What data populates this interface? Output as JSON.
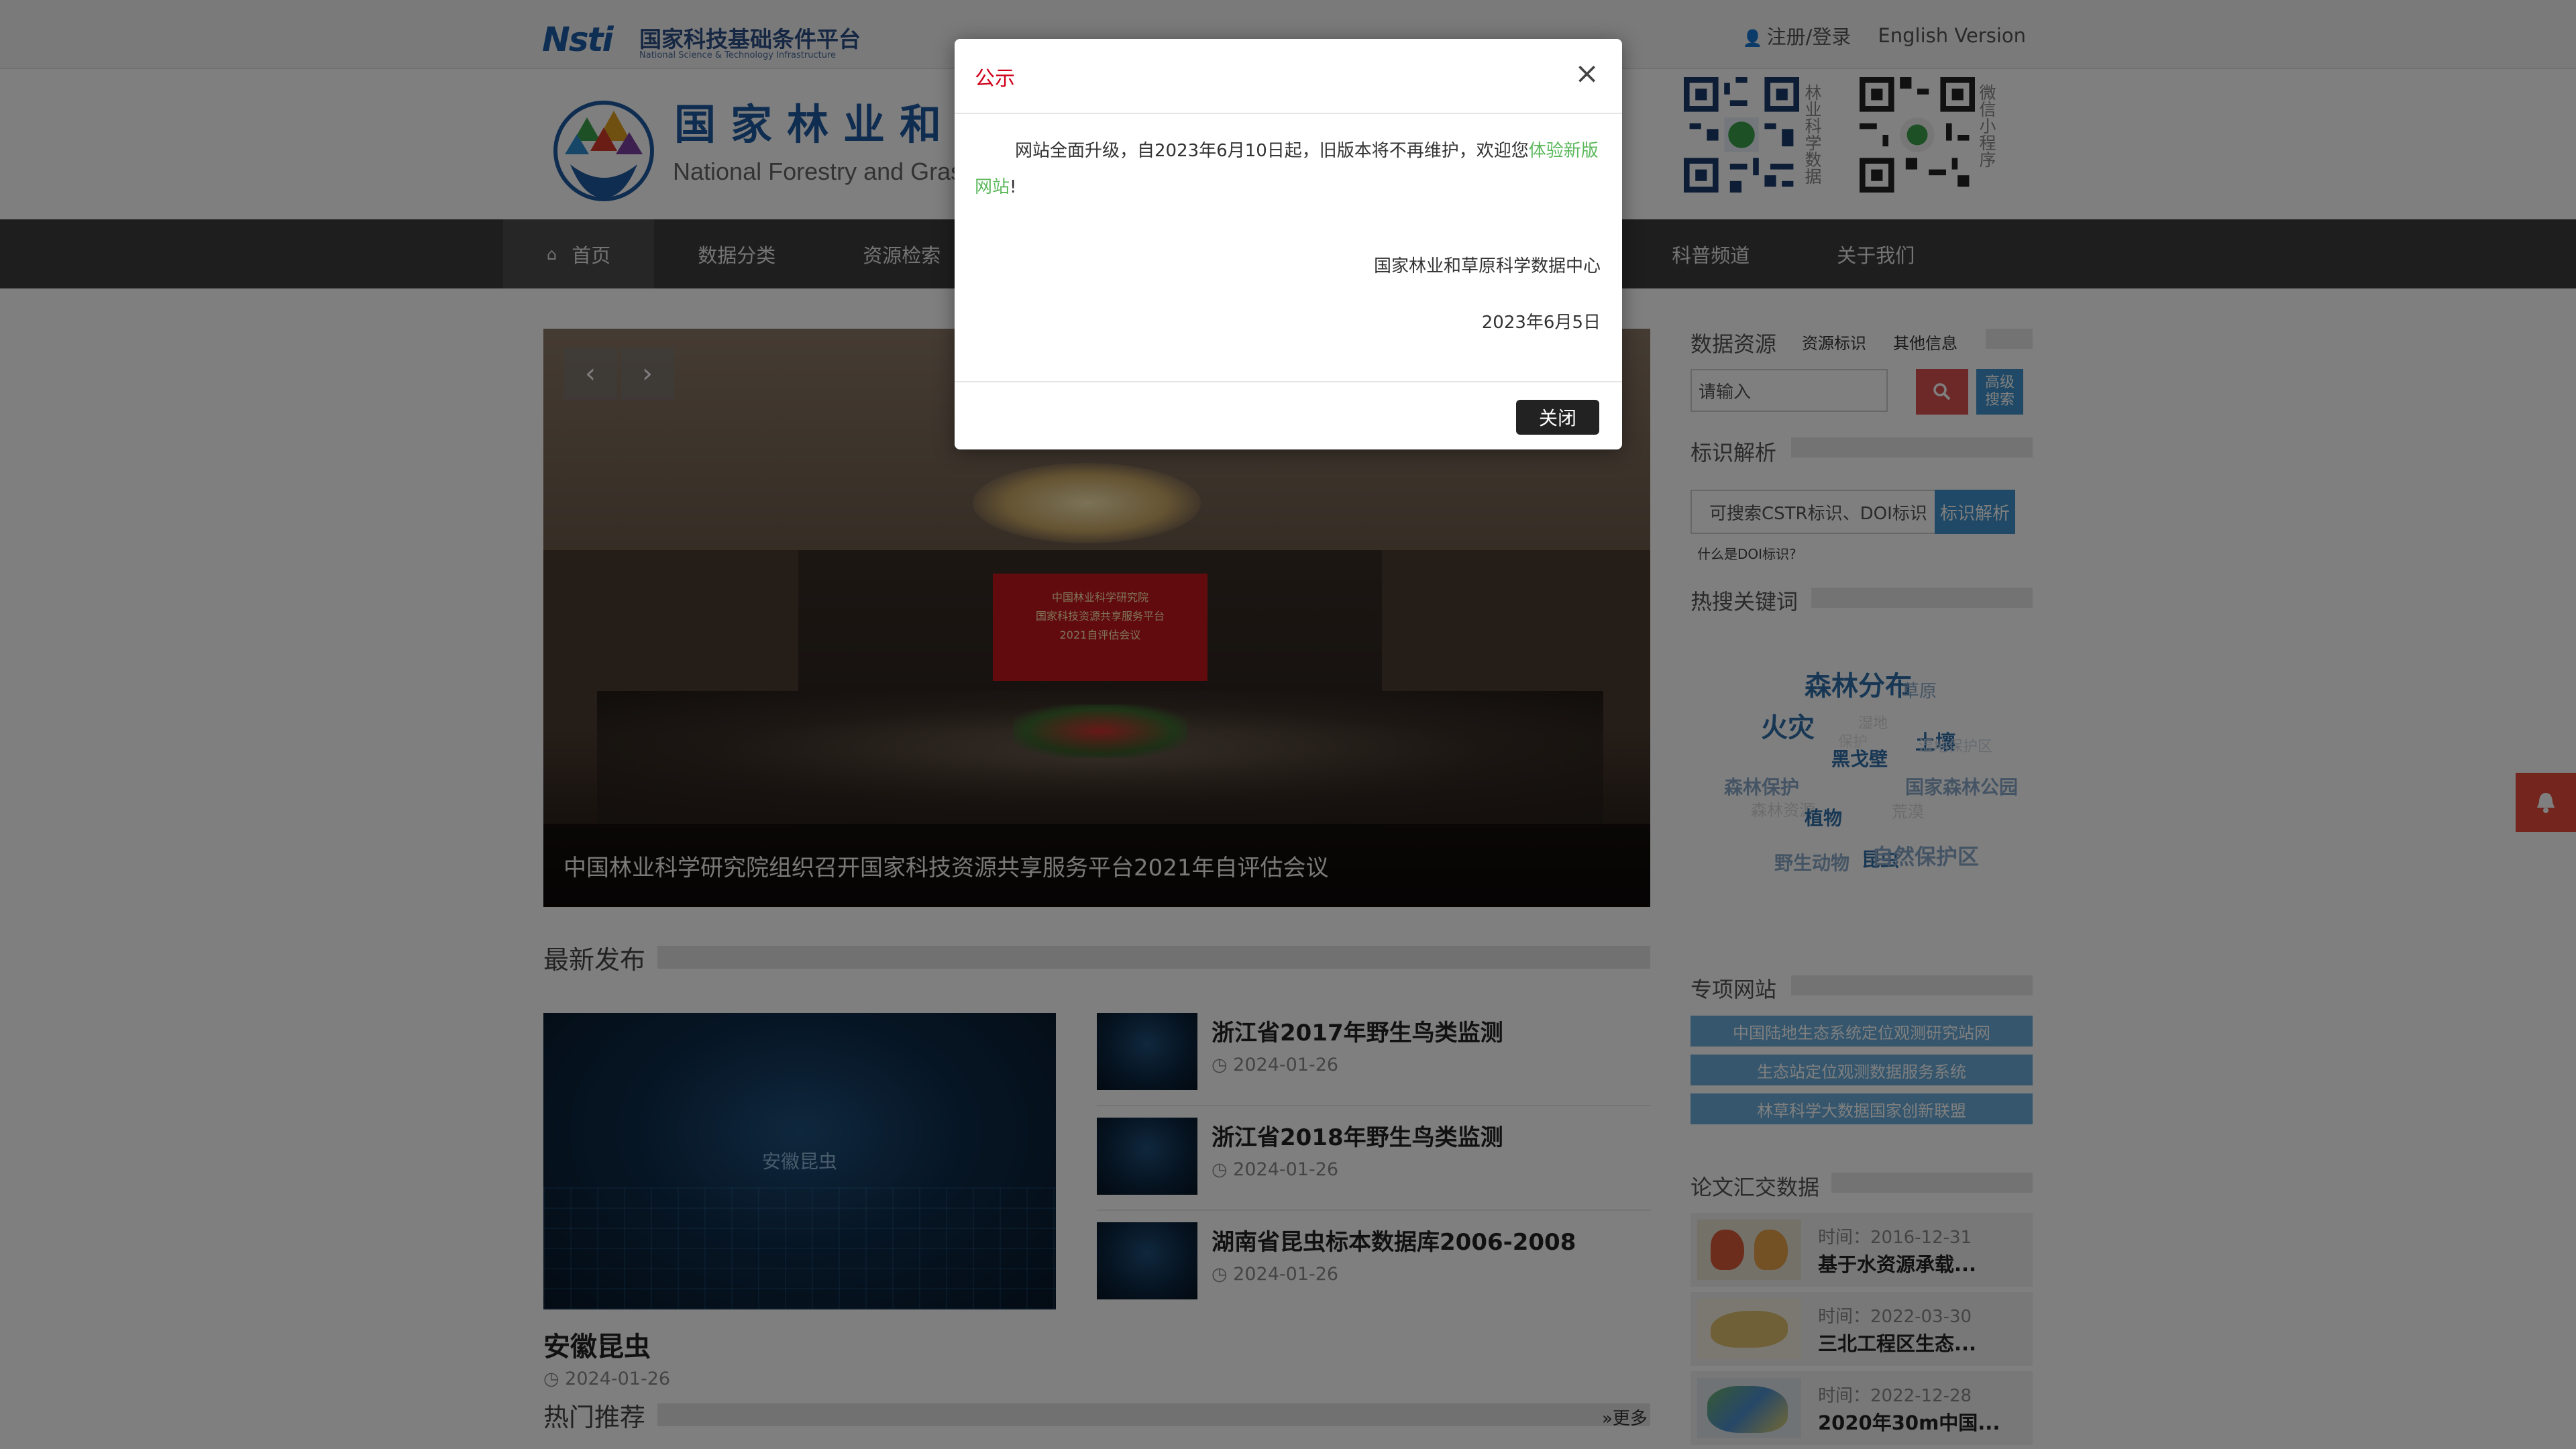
{
  "topbar": {
    "nsti_mark": "Nsti",
    "nsti_cn": "国家科技基础条件平台",
    "nsti_en": "National Science & Technology Infrastructure",
    "login": "注册/登录",
    "english": "English Version"
  },
  "header": {
    "title_cn": "国家林业和",
    "title_en": "National Forestry and Gras",
    "qr1_label": "林业科学数据",
    "qr2_label": "微信小程序"
  },
  "nav": {
    "items": [
      "首页",
      "数据分类",
      "资源检索",
      "科普频道",
      "关于我们"
    ]
  },
  "carousel": {
    "caption": "中国林业科学研究院组织召开国家科技资源共享服务平台2021年自评估会议",
    "screen_text": [
      "中国林业科学研究院",
      "国家科技资源共享服务平台",
      "2021自评估会议"
    ],
    "prev": "‹",
    "next": "›"
  },
  "latest": {
    "title": "最新发布",
    "feature": {
      "image_text": "安徽昆虫",
      "title": "安徽昆虫",
      "date": "2024-01-26"
    },
    "items": [
      {
        "title": "浙江省2017年野生鸟类监测",
        "date": "2024-01-26"
      },
      {
        "title": "浙江省2018年野生鸟类监测",
        "date": "2024-01-26"
      },
      {
        "title": "湖南省昆虫标本数据库2006-2008",
        "date": "2024-01-26"
      }
    ]
  },
  "hot": {
    "title": "热门推荐",
    "more": "»更多"
  },
  "sidebar": {
    "data_resources": {
      "title": "数据资源",
      "tab1": "资源标识",
      "tab2": "其他信息",
      "placeholder": "请输入",
      "adv_search": "高级搜索"
    },
    "id_resolve": {
      "title": "标识解析",
      "placeholder": "可搜索CSTR标识、DOI标识",
      "button": "标识解析",
      "help": "什么是DOI标识?"
    },
    "keywords": {
      "title": "热搜关键词",
      "tags": [
        "森林分布",
        "湿地",
        "草原",
        "火灾",
        "保护",
        "土壤",
        "黑戈壁",
        "湿地保护区",
        "森林保护",
        "国家森林公园",
        "森林资源",
        "植物",
        "荒漠",
        "野生动物",
        "昆虫",
        "自然保护区"
      ]
    },
    "sites": {
      "title": "专项网站",
      "items": [
        "中国陆地生态系统定位观测研究站网",
        "生态站定位观测数据服务系统",
        "林草科学大数据国家创新联盟"
      ]
    },
    "papers": {
      "title": "论文汇交数据",
      "items": [
        {
          "date": "时间：2016-12-31",
          "title": "基于水资源承载..."
        },
        {
          "date": "时间：2022-03-30",
          "title": "三北工程区生态..."
        },
        {
          "date": "时间：2022-12-28",
          "title": "2020年30m中国..."
        }
      ]
    }
  },
  "modal": {
    "title": "公示",
    "body_prefix": "网站全面升级，自2023年6月10日起，旧版本将不再维护，欢迎您",
    "body_link": "体验新版网站",
    "body_suffix": "!",
    "org": "国家林业和草原科学数据中心",
    "date": "2023年6月5日",
    "close_x": "×",
    "close_button": "关闭"
  },
  "colors": {
    "accent_red": "#d0021b",
    "nav_bg": "#3c3c3c",
    "link_green": "#5cb85c",
    "sidebar_blue": "#6aaddb",
    "search_red": "#d9534f"
  }
}
